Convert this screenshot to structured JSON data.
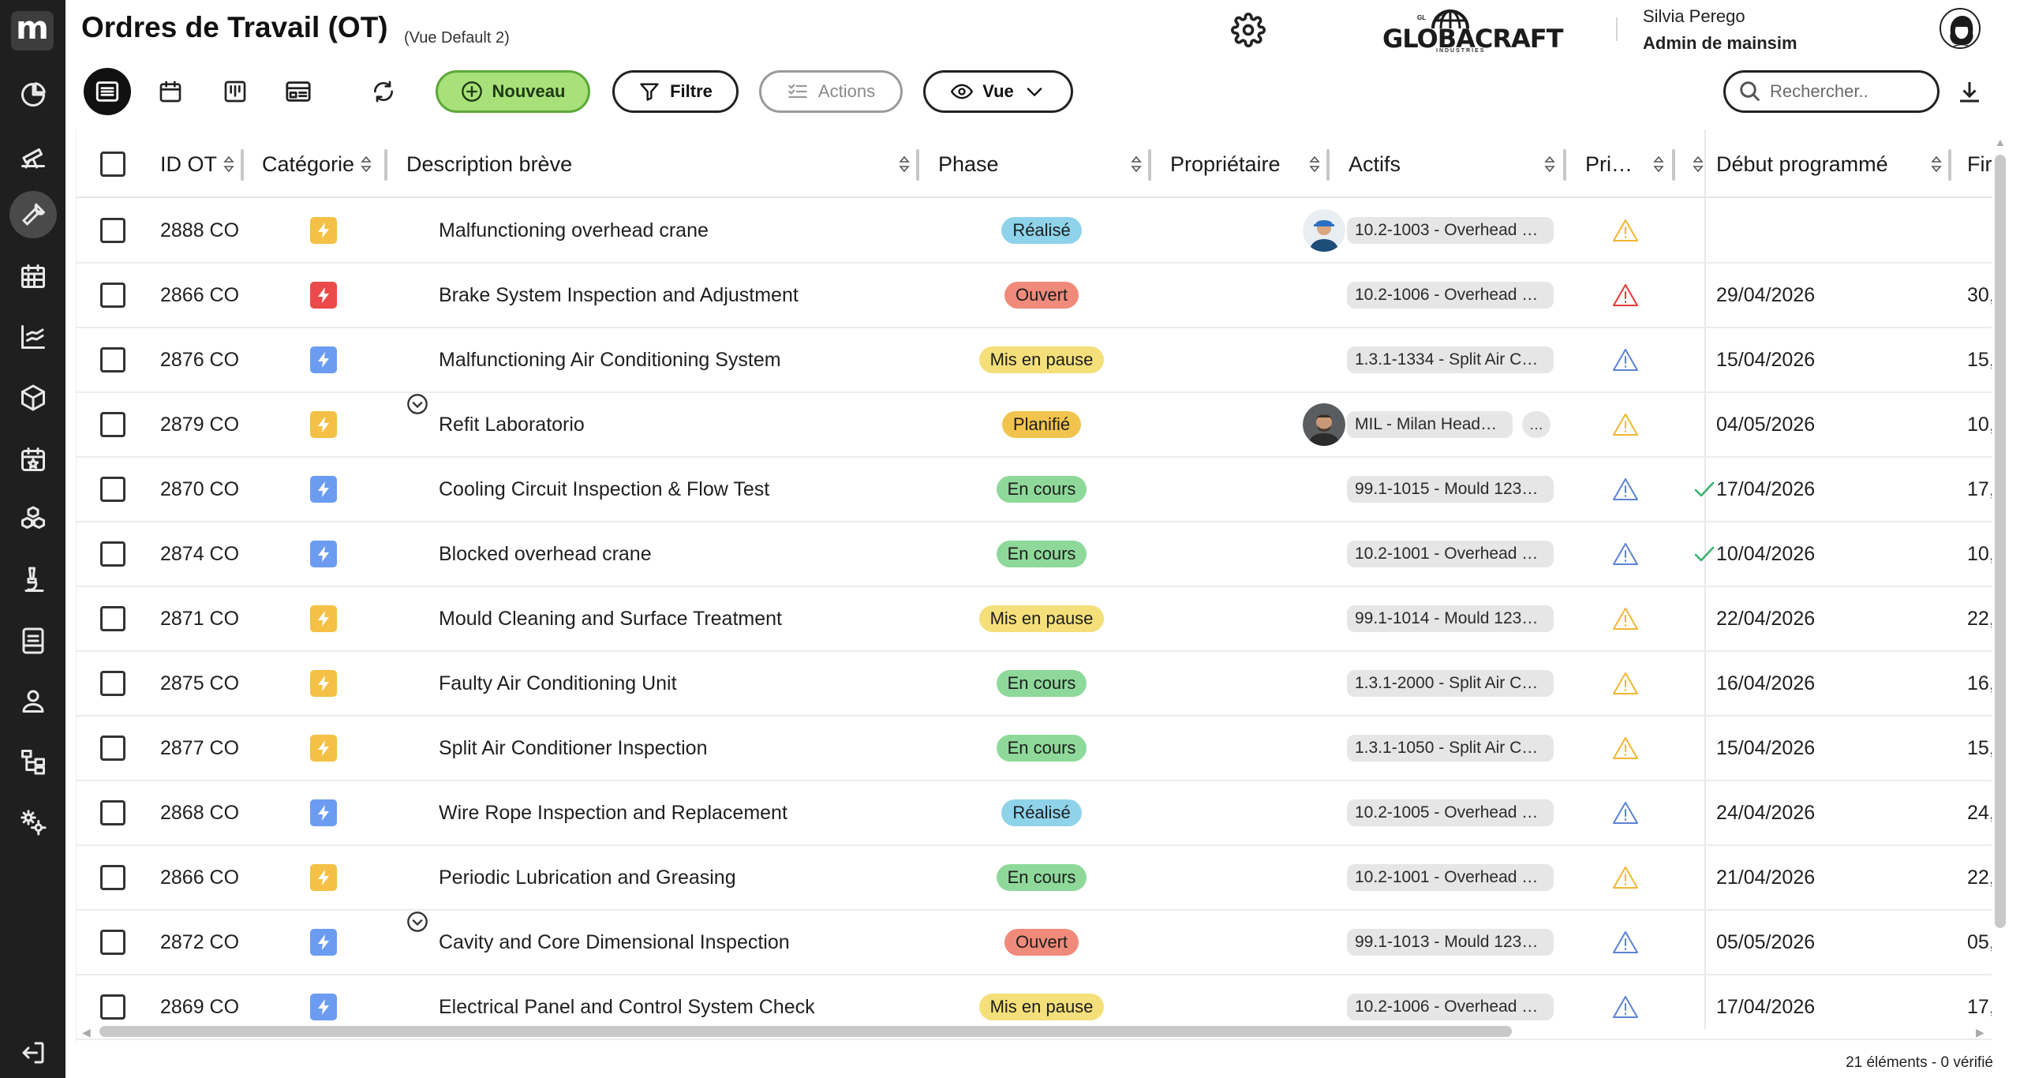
{
  "app": {
    "logo_letter": "m",
    "title": "Ordres de Travail (OT)",
    "view_name": "(Vue Default 2)",
    "brand_name": "GLOBACRAFT",
    "brand_sub": "INDUSTRIES",
    "brand_top": "GL      93"
  },
  "user": {
    "name": "Silvia Perego",
    "role": "Admin de mainsim"
  },
  "sidebar": {
    "items": [
      {
        "icon": "pie-chart-icon"
      },
      {
        "icon": "telescope-icon"
      },
      {
        "icon": "wrench-icon",
        "active": true
      },
      {
        "icon": "calendar-grid-icon"
      },
      {
        "icon": "line-chart-icon"
      },
      {
        "icon": "box-icon"
      },
      {
        "icon": "calendar-star-icon"
      },
      {
        "icon": "cubes-icon"
      },
      {
        "icon": "microscope-icon"
      },
      {
        "icon": "document-icon"
      },
      {
        "icon": "user-icon"
      },
      {
        "icon": "hierarchy-icon"
      },
      {
        "icon": "settings-icon"
      },
      {
        "icon": "logout-icon"
      }
    ]
  },
  "toolbar": {
    "new_label": "Nouveau",
    "filter_label": "Filtre",
    "actions_label": "Actions",
    "view_label": "Vue",
    "search_placeholder": "Rechercher.."
  },
  "columns": {
    "id": "ID OT",
    "category": "Catégorie",
    "description": "Description brève",
    "phase": "Phase",
    "owner": "Propriétaire",
    "assets": "Actifs",
    "priority": "Pri…",
    "start": "Début programmé",
    "end": "Fir"
  },
  "colors": {
    "cat_yellow": "#f4c046",
    "cat_blue": "#6b9cf2",
    "cat_red": "#ec4a4a",
    "phase_done": "#8fd3ea",
    "phase_open": "#f08a7a",
    "phase_paused": "#f4df7a",
    "phase_planned": "#f2c44e",
    "phase_progress": "#8ed99a",
    "prio_yellow": "#f2b632",
    "prio_red": "#e53935",
    "prio_blue": "#5b82d6"
  },
  "rows": [
    {
      "id": "2888 CO",
      "cat": "yellow",
      "desc": "Malfunctioning overhead crane",
      "expand": false,
      "phase": "Réalisé",
      "phase_color": "done",
      "owner": "worker",
      "asset": "10.2-1003 - Overhead …",
      "more": false,
      "prio": "yellow",
      "check": false,
      "start": "",
      "end": ""
    },
    {
      "id": "2866 CO",
      "cat": "red",
      "desc": "Brake System Inspection and Adjustment",
      "expand": false,
      "phase": "Ouvert",
      "phase_color": "open",
      "owner": "",
      "asset": "10.2-1006 - Overhead …",
      "more": false,
      "prio": "red",
      "check": false,
      "start": "29/04/2026",
      "end": "30,"
    },
    {
      "id": "2876 CO",
      "cat": "blue",
      "desc": "Malfunctioning Air Conditioning System",
      "expand": false,
      "phase": "Mis en pause",
      "phase_color": "paused",
      "owner": "",
      "asset": "1.3.1-1334 - Split Air C…",
      "more": false,
      "prio": "blue",
      "check": false,
      "start": "15/04/2026",
      "end": "15,"
    },
    {
      "id": "2879 CO",
      "cat": "yellow",
      "desc": "Refit Laboratorio",
      "expand": true,
      "phase": "Planifié",
      "phase_color": "planned",
      "owner": "man",
      "asset": "MIL - Milan Head…",
      "more": true,
      "prio": "yellow",
      "check": false,
      "start": "04/05/2026",
      "end": "10,"
    },
    {
      "id": "2870 CO",
      "cat": "blue",
      "desc": "Cooling Circuit Inspection & Flow Test",
      "expand": false,
      "phase": "En cours",
      "phase_color": "progress",
      "owner": "",
      "asset": "99.1-1015 - Mould 123…",
      "more": false,
      "prio": "blue",
      "check": true,
      "start": "17/04/2026",
      "end": "17,"
    },
    {
      "id": "2874 CO",
      "cat": "blue",
      "desc": "Blocked overhead crane",
      "expand": false,
      "phase": "En cours",
      "phase_color": "progress",
      "owner": "",
      "asset": "10.2-1001 - Overhead …",
      "more": false,
      "prio": "blue",
      "check": true,
      "start": "10/04/2026",
      "end": "10,"
    },
    {
      "id": "2871 CO",
      "cat": "yellow",
      "desc": "Mould Cleaning and Surface Treatment",
      "expand": false,
      "phase": "Mis en pause",
      "phase_color": "paused",
      "owner": "",
      "asset": "99.1-1014 - Mould 123…",
      "more": false,
      "prio": "yellow",
      "check": false,
      "start": "22/04/2026",
      "end": "22,"
    },
    {
      "id": "2875 CO",
      "cat": "yellow",
      "desc": "Faulty Air Conditioning Unit",
      "expand": false,
      "phase": "En cours",
      "phase_color": "progress",
      "owner": "",
      "asset": "1.3.1-2000 - Split Air C…",
      "more": false,
      "prio": "yellow",
      "check": false,
      "start": "16/04/2026",
      "end": "16,"
    },
    {
      "id": "2877 CO",
      "cat": "yellow",
      "desc": "Split Air Conditioner Inspection",
      "expand": false,
      "phase": "En cours",
      "phase_color": "progress",
      "owner": "",
      "asset": "1.3.1-1050 - Split Air C…",
      "more": false,
      "prio": "yellow",
      "check": false,
      "start": "15/04/2026",
      "end": "15,"
    },
    {
      "id": "2868 CO",
      "cat": "blue",
      "desc": "Wire Rope Inspection and Replacement",
      "expand": false,
      "phase": "Réalisé",
      "phase_color": "done",
      "owner": "",
      "asset": "10.2-1005 - Overhead …",
      "more": false,
      "prio": "blue",
      "check": false,
      "start": "24/04/2026",
      "end": "24,"
    },
    {
      "id": "2866 CO",
      "cat": "yellow",
      "desc": "Periodic Lubrication and Greasing",
      "expand": false,
      "phase": "En cours",
      "phase_color": "progress",
      "owner": "",
      "asset": "10.2-1001 - Overhead …",
      "more": false,
      "prio": "yellow",
      "check": false,
      "start": "21/04/2026",
      "end": "22,"
    },
    {
      "id": "2872 CO",
      "cat": "blue",
      "desc": "Cavity and Core Dimensional Inspection",
      "expand": true,
      "phase": "Ouvert",
      "phase_color": "open",
      "owner": "",
      "asset": "99.1-1013 - Mould 123…",
      "more": false,
      "prio": "blue",
      "check": false,
      "start": "05/05/2026",
      "end": "05,"
    },
    {
      "id": "2869 CO",
      "cat": "blue",
      "desc": "Electrical Panel and Control System Check",
      "expand": false,
      "phase": "Mis en pause",
      "phase_color": "paused",
      "owner": "",
      "asset": "10.2-1006 - Overhead …",
      "more": false,
      "prio": "blue",
      "check": false,
      "start": "17/04/2026",
      "end": "17,"
    }
  ],
  "footer": {
    "count": "21 éléments - 0 vérifié"
  }
}
